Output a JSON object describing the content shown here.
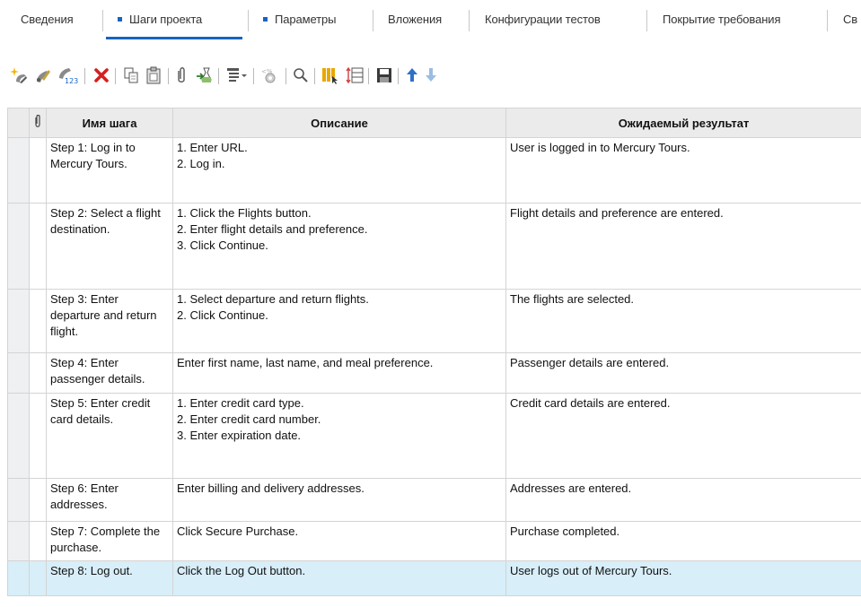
{
  "tabs": [
    {
      "label": "Сведения",
      "active": false,
      "dot": false
    },
    {
      "label": "Шаги проекта",
      "active": true,
      "dot": true
    },
    {
      "label": "Параметры",
      "active": false,
      "dot": true
    },
    {
      "label": "Вложения",
      "active": false,
      "dot": false
    },
    {
      "label": "Конфигурации тестов",
      "active": false,
      "dot": false
    },
    {
      "label": "Покрытие требования",
      "active": false,
      "dot": false
    },
    {
      "label": "Св",
      "active": false,
      "dot": false
    }
  ],
  "toolbar": {
    "icons": [
      "new-step-icon",
      "edit-step-icon",
      "renumber-steps-icon",
      "delete-icon",
      "copy-icon",
      "paste-icon",
      "attachment-icon",
      "call-to-test-icon",
      "generate-script-icon",
      "insert-parameter-icon",
      "find-icon",
      "select-columns-icon",
      "adjust-row-height-icon",
      "save-icon",
      "move-up-icon",
      "move-down-icon"
    ]
  },
  "colors": {
    "accent": "#1565c0",
    "selected_row": "#d8eef9",
    "header_bg": "#ebebeb"
  },
  "grid": {
    "columns": {
      "attachment": "",
      "name": "Имя шага",
      "description": "Описание",
      "expected": "Ожидаемый результат"
    },
    "rows": [
      {
        "name": "Step 1: Log in to Mercury Tours.",
        "description": [
          "1. Enter URL.",
          "2. Log in."
        ],
        "expected": "User is logged in to Mercury Tours."
      },
      {
        "name": "Step 2: Select a flight destination.",
        "description": [
          "1. Click the Flights button.",
          "2. Enter flight details and preference.",
          "3. Click Continue."
        ],
        "expected": "Flight details and preference are entered."
      },
      {
        "name": "Step 3: Enter departure and return flight.",
        "description": [
          "1. Select departure and return flights.",
          "2. Click Continue."
        ],
        "expected": "The flights are selected."
      },
      {
        "name": "Step 4: Enter passenger details.",
        "description": [
          "Enter first name, last name, and meal preference."
        ],
        "expected": "Passenger details are entered."
      },
      {
        "name": "Step 5: Enter credit card details.",
        "description": [
          "1. Enter credit card type.",
          "2. Enter credit card number.",
          "3. Enter expiration date."
        ],
        "expected": "Credit card details are entered."
      },
      {
        "name": "Step 6: Enter addresses.",
        "description": [
          "Enter billing and delivery addresses."
        ],
        "expected": "Addresses are entered."
      },
      {
        "name": "Step 7: Complete the purchase.",
        "description": [
          "Click Secure Purchase."
        ],
        "expected": "Purchase completed."
      },
      {
        "name": "Step 8: Log out.",
        "description": [
          "Click the Log Out button."
        ],
        "expected": "User logs out of Mercury Tours.",
        "selected": true
      }
    ]
  }
}
